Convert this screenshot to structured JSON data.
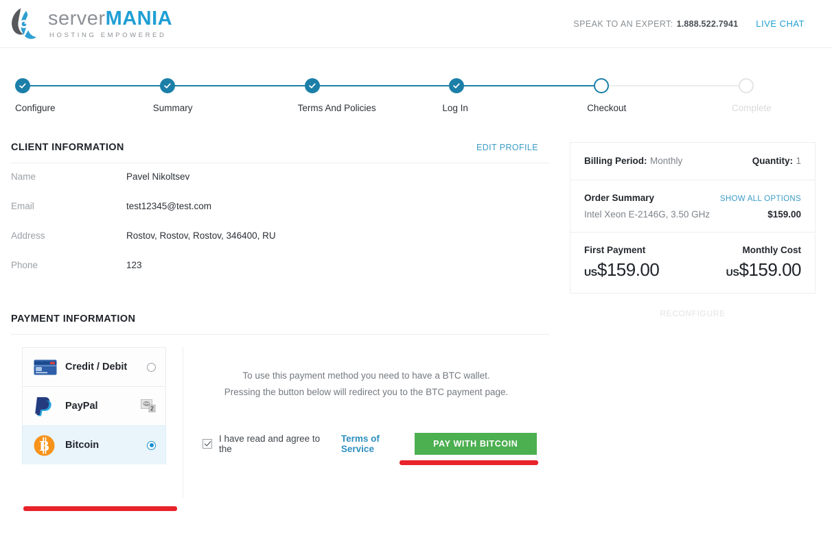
{
  "header": {
    "brand_word1": "server",
    "brand_word2": "MANIA",
    "brand_tagline": "HOSTING EMPOWERED",
    "expert_label": "SPEAK TO AN EXPERT:",
    "expert_phone": "1.888.522.7941",
    "live_chat": "LIVE CHAT"
  },
  "steps": [
    {
      "label": "Configure",
      "state": "done"
    },
    {
      "label": "Summary",
      "state": "done"
    },
    {
      "label": "Terms And Policies",
      "state": "done"
    },
    {
      "label": "Log In",
      "state": "done"
    },
    {
      "label": "Checkout",
      "state": "current"
    },
    {
      "label": "Complete",
      "state": "upcoming"
    }
  ],
  "client": {
    "title": "CLIENT INFORMATION",
    "edit_label": "EDIT PROFILE",
    "fields": [
      {
        "key": "Name",
        "value": "Pavel Nikoltsev"
      },
      {
        "key": "Email",
        "value": "test12345@test.com"
      },
      {
        "key": "Address",
        "value": "Rostov, Rostov, Rostov, 346400, RU"
      },
      {
        "key": "Phone",
        "value": "123"
      }
    ]
  },
  "payment": {
    "title": "PAYMENT INFORMATION",
    "methods": [
      {
        "label": "Credit / Debit",
        "icon": "credit-card-icon",
        "selected": false
      },
      {
        "label": "PayPal",
        "icon": "paypal-icon",
        "selected": false
      },
      {
        "label": "Bitcoin",
        "icon": "bitcoin-icon",
        "selected": true
      }
    ],
    "note_line1": "To use this payment method you need to have a BTC wallet.",
    "note_line2": "Pressing the button below will redirect you to the BTC payment page.",
    "agree_text": "I have read and agree to the",
    "tos_link": "Terms of Service",
    "agree_checked": true,
    "pay_button": "PAY WITH BITCOIN"
  },
  "summary": {
    "billing_label": "Billing Period:",
    "billing_value": "Monthly",
    "quantity_label": "Quantity:",
    "quantity_value": "1",
    "order_title": "Order Summary",
    "show_all_options": "SHOW ALL OPTIONS",
    "item_name": "Intel Xeon E-2146G, 3.50 GHz",
    "item_price": "$159.00",
    "first_payment_label": "First Payment",
    "first_payment_currency": "US",
    "first_payment_amount": "$159.00",
    "monthly_cost_label": "Monthly Cost",
    "monthly_cost_currency": "US",
    "monthly_cost_amount": "$159.00",
    "reconfigure": "RECONFIGURE"
  },
  "colors": {
    "accent_blue": "#1f9fd4",
    "step_blue": "#1b7fa8",
    "pay_green": "#4caf50",
    "highlight_red": "#e8232a",
    "bitcoin_orange": "#f7931a"
  }
}
